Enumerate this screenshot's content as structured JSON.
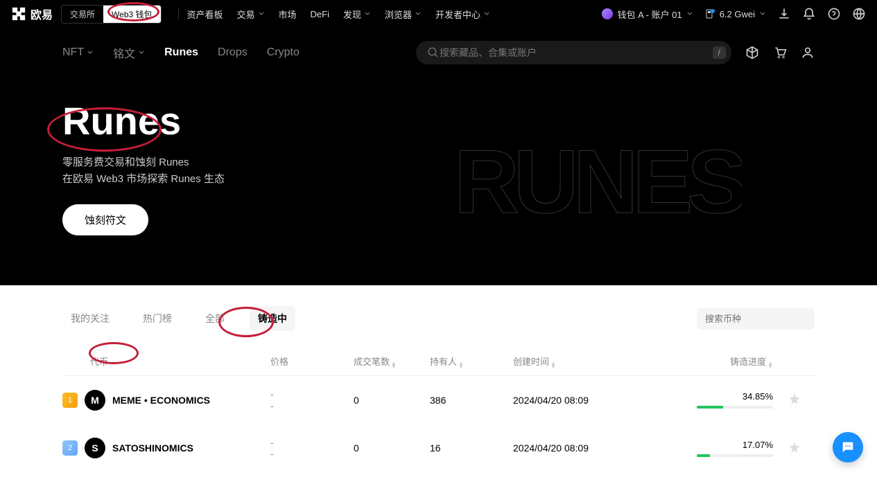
{
  "topbar": {
    "brand": "欧易",
    "tabs": {
      "exchange": "交易所",
      "web3": "Web3 钱包"
    },
    "nav": {
      "dashboard": "资产看板",
      "trade": "交易",
      "market": "市场",
      "defi": "DeFi",
      "discover": "发现",
      "browser": "浏览器",
      "devcenter": "开发者中心"
    },
    "wallet_label": "钱包 A - 账户 01",
    "gwei_label": "6.2 Gwei"
  },
  "secnav": {
    "nft": "NFT",
    "mingwen": "铭文",
    "runes": "Runes",
    "drops": "Drops",
    "crypto": "Crypto"
  },
  "search": {
    "placeholder": "搜索藏品、合集或账户",
    "kbd": "/"
  },
  "hero": {
    "title": "Runes",
    "sub1": "零服务费交易和蚀刻 Runes",
    "sub2": "在欧易 Web3 市场探索 Runes 生态",
    "btn": "蚀刻符文",
    "art": "RUNES"
  },
  "filters": {
    "follow": "我的关注",
    "hot": "热门榜",
    "all": "全部",
    "minting": "铸造中",
    "search_ph": "搜索币种"
  },
  "table": {
    "head": {
      "token": "代币",
      "price": "价格",
      "vol": "成交笔数",
      "holders": "持有人",
      "time": "创建时间",
      "progress": "铸造进度"
    },
    "rows": [
      {
        "rank": "1",
        "initial": "M",
        "name": "MEME • ECONOMICS",
        "price1": "-",
        "price2": "-",
        "vol": "0",
        "holders": "386",
        "time": "2024/04/20 08:09",
        "pct": "34.85%",
        "pctnum": 34.85
      },
      {
        "rank": "2",
        "initial": "S",
        "name": "SATOSHINOMICS",
        "price1": "-",
        "price2": "-",
        "vol": "0",
        "holders": "16",
        "time": "2024/04/20 08:09",
        "pct": "17.07%",
        "pctnum": 17.07
      }
    ]
  }
}
